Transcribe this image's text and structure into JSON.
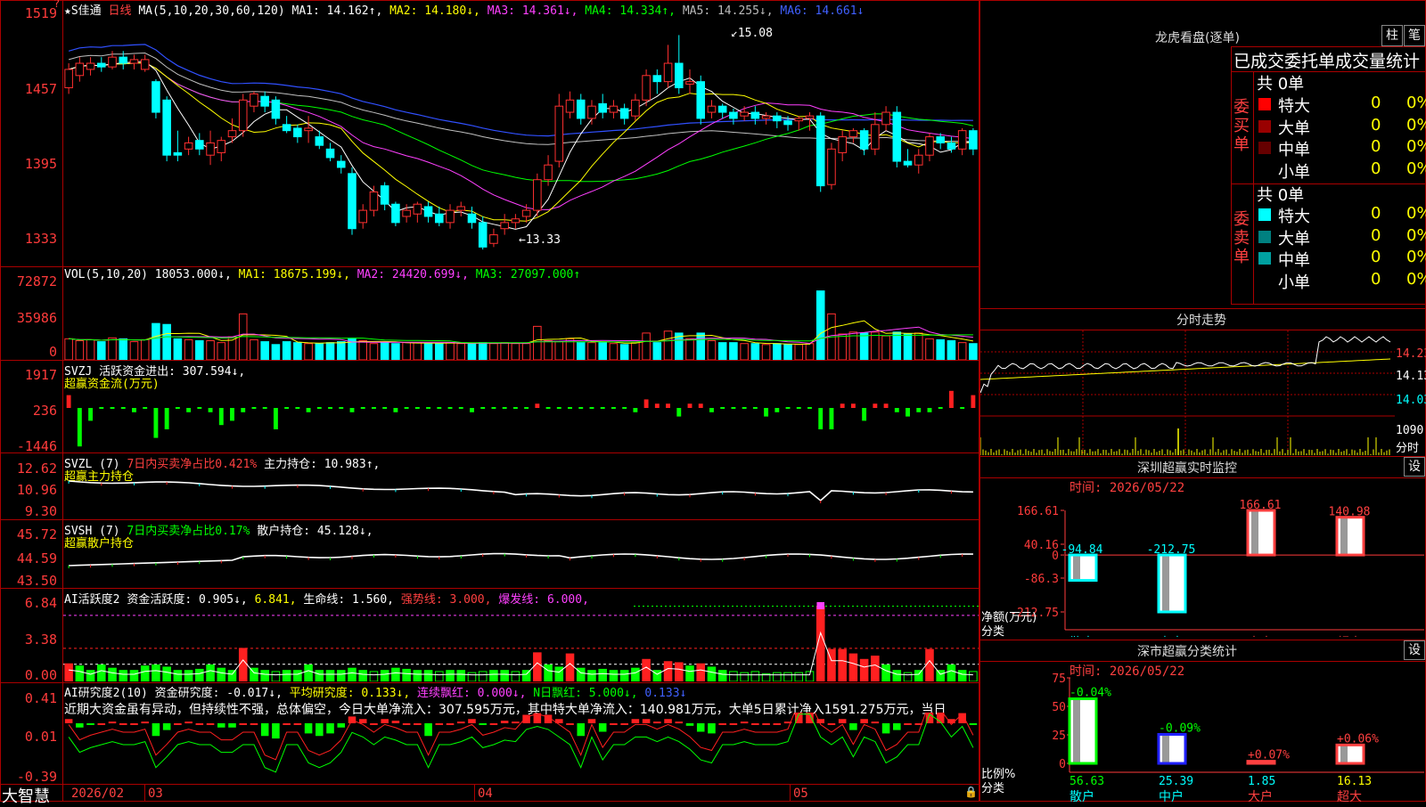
{
  "kline": {
    "header": {
      "title": "★S佳通",
      "period": "日线",
      "ma_label": "MA(5,10,20,30,60,120)",
      "ma1": "MA1: 14.162↑,",
      "ma2": "MA2: 14.180↓,",
      "ma3": "MA3: 14.361↓,",
      "ma4": "MA4: 14.334↑,",
      "ma5": "MA5: 14.255↓,",
      "ma6": "MA6: 14.661↓"
    },
    "yaxis": [
      "1519",
      "1457",
      "1395",
      "1333"
    ],
    "corner_mark": "?",
    "high_label": "15.08",
    "low_label": "13.33",
    "candles": [
      [
        14.65,
        14.8,
        14.6,
        14.85
      ],
      [
        14.75,
        14.85,
        14.7,
        14.9
      ],
      [
        14.8,
        14.85,
        14.75,
        14.9
      ],
      [
        14.85,
        14.82,
        14.78,
        14.9
      ],
      [
        14.82,
        14.9,
        14.8,
        14.95
      ],
      [
        14.9,
        14.85,
        14.8,
        14.95
      ],
      [
        14.85,
        14.88,
        14.8,
        14.92
      ],
      [
        14.8,
        14.88,
        14.78,
        14.92
      ],
      [
        14.7,
        14.45,
        14.4,
        14.72
      ],
      [
        14.55,
        14.1,
        14.05,
        14.58
      ],
      [
        14.12,
        14.1,
        14.05,
        14.3
      ],
      [
        14.15,
        14.2,
        14.1,
        14.25
      ],
      [
        14.22,
        14.15,
        14.1,
        14.28
      ],
      [
        14.1,
        14.2,
        14.02,
        14.3
      ],
      [
        14.12,
        14.22,
        14.05,
        14.25
      ],
      [
        14.25,
        14.3,
        14.2,
        14.4
      ],
      [
        14.3,
        14.55,
        14.25,
        14.6
      ],
      [
        14.5,
        14.6,
        14.45,
        14.62
      ],
      [
        14.58,
        14.5,
        14.45,
        14.62
      ],
      [
        14.55,
        14.4,
        14.35,
        14.58
      ],
      [
        14.35,
        14.3,
        14.28,
        14.42
      ],
      [
        14.32,
        14.25,
        14.2,
        14.35
      ],
      [
        14.3,
        14.32,
        14.2,
        14.42
      ],
      [
        14.25,
        14.18,
        14.15,
        14.3
      ],
      [
        14.15,
        14.08,
        14.05,
        14.2
      ],
      [
        14.05,
        14.0,
        13.95,
        14.1
      ],
      [
        13.95,
        13.5,
        13.45,
        14.0
      ],
      [
        13.55,
        13.65,
        13.5,
        13.7
      ],
      [
        13.65,
        13.8,
        13.6,
        13.85
      ],
      [
        13.85,
        13.7,
        13.65,
        13.88
      ],
      [
        13.7,
        13.55,
        13.52,
        13.72
      ],
      [
        13.6,
        13.65,
        13.55,
        13.7
      ],
      [
        13.62,
        13.7,
        13.55,
        13.72
      ],
      [
        13.68,
        13.6,
        13.55,
        13.72
      ],
      [
        13.62,
        13.55,
        13.52,
        13.68
      ],
      [
        13.55,
        13.65,
        13.5,
        13.7
      ],
      [
        13.65,
        13.68,
        13.6,
        13.72
      ],
      [
        13.62,
        13.55,
        13.5,
        13.68
      ],
      [
        13.55,
        13.35,
        13.33,
        13.6
      ],
      [
        13.38,
        13.45,
        13.35,
        13.5
      ],
      [
        13.5,
        13.55,
        13.45,
        13.62
      ],
      [
        13.55,
        13.58,
        13.5,
        13.62
      ],
      [
        13.6,
        13.65,
        13.55,
        13.7
      ],
      [
        13.65,
        13.9,
        13.6,
        13.95
      ],
      [
        13.9,
        14.02,
        13.85,
        14.1
      ],
      [
        14.05,
        14.5,
        14.0,
        14.6
      ],
      [
        14.45,
        14.55,
        14.4,
        14.62
      ],
      [
        14.55,
        14.4,
        14.35,
        14.6
      ],
      [
        14.4,
        14.5,
        14.35,
        14.55
      ],
      [
        14.52,
        14.45,
        14.4,
        14.6
      ],
      [
        14.45,
        14.5,
        14.4,
        14.55
      ],
      [
        14.48,
        14.4,
        14.35,
        14.52
      ],
      [
        14.42,
        14.55,
        14.38,
        14.6
      ],
      [
        14.55,
        14.75,
        14.5,
        14.8
      ],
      [
        14.75,
        14.7,
        14.6,
        14.8
      ],
      [
        14.7,
        14.85,
        14.65,
        15.0
      ],
      [
        14.85,
        14.65,
        14.6,
        15.08
      ],
      [
        14.68,
        14.7,
        14.6,
        14.8
      ],
      [
        14.7,
        14.4,
        14.35,
        14.75
      ],
      [
        14.45,
        14.5,
        14.4,
        14.55
      ],
      [
        14.5,
        14.45,
        14.4,
        14.52
      ],
      [
        14.45,
        14.4,
        14.35,
        14.48
      ],
      [
        14.42,
        14.45,
        14.38,
        14.5
      ],
      [
        14.45,
        14.4,
        14.35,
        14.5
      ],
      [
        14.4,
        14.42,
        14.35,
        14.45
      ],
      [
        14.42,
        14.38,
        14.32,
        14.45
      ],
      [
        14.38,
        14.35,
        14.3,
        14.42
      ],
      [
        14.38,
        14.4,
        14.3,
        14.42
      ],
      [
        14.4,
        14.42,
        14.3,
        14.45
      ],
      [
        14.42,
        13.85,
        13.8,
        14.45
      ],
      [
        13.86,
        14.15,
        13.82,
        14.2
      ],
      [
        14.12,
        14.25,
        14.05,
        14.3
      ],
      [
        14.25,
        14.3,
        14.2,
        14.32
      ],
      [
        14.3,
        14.15,
        14.1,
        14.32
      ],
      [
        14.15,
        14.35,
        14.1,
        14.45
      ],
      [
        14.35,
        14.45,
        14.3,
        14.5
      ],
      [
        14.45,
        14.05,
        14.0,
        14.5
      ],
      [
        14.05,
        14.02,
        14.0,
        14.15
      ],
      [
        14.02,
        14.1,
        13.95,
        14.15
      ],
      [
        14.1,
        14.25,
        14.05,
        14.28
      ],
      [
        14.25,
        14.2,
        14.15,
        14.28
      ],
      [
        14.2,
        14.15,
        14.12,
        14.25
      ],
      [
        14.15,
        14.3,
        14.1,
        14.32
      ],
      [
        14.3,
        14.15,
        14.1,
        14.32
      ]
    ]
  },
  "vol": {
    "header": {
      "label": "VOL(5,10,20)",
      "value": "18053.000↓,",
      "ma1": "MA1: 18675.199↓,",
      "ma2": "MA2: 24420.699↓,",
      "ma3": "MA3: 27097.000↑"
    },
    "yaxis": [
      "72872",
      "35986",
      "0"
    ],
    "values": [
      22,
      20,
      21,
      19,
      23,
      22,
      19,
      21,
      38,
      37,
      22,
      21,
      20,
      20,
      18,
      24,
      48,
      21,
      19,
      16,
      19,
      18,
      17,
      17,
      18,
      19,
      22,
      20,
      17,
      18,
      17,
      18,
      18,
      17,
      17,
      18,
      17,
      17,
      18,
      17,
      18,
      17,
      17,
      35,
      20,
      19,
      22,
      18,
      18,
      18,
      17,
      16,
      18,
      28,
      18,
      30,
      28,
      22,
      28,
      20,
      18,
      18,
      17,
      17,
      16,
      17,
      16,
      16,
      17,
      72,
      48,
      27,
      29,
      28,
      29,
      25,
      29,
      27,
      28,
      22,
      21,
      20,
      18,
      17
    ]
  },
  "svzj": {
    "header": {
      "label": "SVZJ",
      "name": "活跃资金进出:",
      "value": "307.594↓,",
      "sub": "超赢资金流(万元)"
    },
    "yaxis": [
      "1917",
      "236",
      "-1446"
    ],
    "values": [
      3,
      -9,
      -3,
      0,
      0,
      0,
      -1,
      0,
      -7,
      -5,
      0,
      -1,
      0,
      -1,
      -4,
      -3,
      -1,
      0,
      0,
      -5,
      0,
      0,
      -1,
      0,
      0,
      0,
      -1,
      0,
      0,
      0,
      -1,
      0,
      0,
      0,
      0,
      0,
      0,
      -1,
      0,
      0,
      0,
      0,
      0,
      1,
      0,
      0,
      0,
      0,
      0,
      0,
      0,
      0,
      -1,
      2,
      1,
      1,
      -2,
      1,
      1,
      -1,
      0,
      0,
      0,
      0,
      -2,
      -1,
      0,
      0,
      0,
      -5,
      -5,
      1,
      1,
      -3,
      1,
      1,
      -1,
      -2,
      -1,
      -1,
      0,
      4,
      0,
      3
    ]
  },
  "svzl": {
    "header": {
      "label": "SVZL (7)",
      "desc": "7日内买卖净占比0.421%",
      "name": "主力持仓:",
      "value": "10.983↑,",
      "sub": "超赢主力持仓"
    },
    "yaxis": [
      "12.62",
      "10.96",
      "9.30"
    ]
  },
  "svsh": {
    "header": {
      "label": "SVSH (7)",
      "desc": "7日内买卖净占比0.17%",
      "name": "散户持仓:",
      "value": "45.128↓,",
      "sub": "超赢散户持仓"
    },
    "yaxis": [
      "45.72",
      "44.59",
      "43.50"
    ]
  },
  "ai2": {
    "header": {
      "label": "AI活跃度2",
      "name": "资金活跃度:",
      "v1": "0.905↓,",
      "v2": "6.841,",
      "life": "生命线: 1.560,",
      "strong": "强势线: 3.000,",
      "burst": "爆发线: 6.000,"
    },
    "yaxis": [
      "6.84",
      "3.38",
      "0.00"
    ],
    "values": [
      1.6,
      1.4,
      1.0,
      1.5,
      1.2,
      1.0,
      1.0,
      1.4,
      1.5,
      1.3,
      1.0,
      1.0,
      1.1,
      1.5,
      1.2,
      1.0,
      3.0,
      1.2,
      1.0,
      0.9,
      1.0,
      1.0,
      1.5,
      1.0,
      1.0,
      1.0,
      1.2,
      1.0,
      0.9,
      1.0,
      1.2,
      1.1,
      1.0,
      1.0,
      0.9,
      1.0,
      1.0,
      0.8,
      0.9,
      1.0,
      1.0,
      0.9,
      1.0,
      2.6,
      1.5,
      1.3,
      2.5,
      1.2,
      1.0,
      1.1,
      1.0,
      1.0,
      1.2,
      2.0,
      1.0,
      1.8,
      1.7,
      1.4,
      1.6,
      1.3,
      1.0,
      0.9,
      0.8,
      0.9,
      0.7,
      0.8,
      0.8,
      0.8,
      0.9,
      6.8,
      2.9,
      2.9,
      2.5,
      2.0,
      2.3,
      1.5,
      1.0,
      0.8,
      1.0,
      2.9,
      1.0,
      1.5,
      1.0,
      0.9
    ]
  },
  "air": {
    "header": {
      "label": "AI研究度2(10)",
      "name": "资金研究度:",
      "v1": "-0.017↓,",
      "avg": "平均研究度: 0.133↓,",
      "red": "连续飘红: 0.000↓,",
      "nred": "N日飘红: 5.000↓,",
      "tail": "0.133↓"
    },
    "text": "近期大资金虽有异动，但持续性不强，总体偏空，今日大单净流入：307.595万元，其中特大单净流入：140.981万元，大单5日累计净入1591.275万元，当日",
    "yaxis": [
      "0.41",
      "0.01",
      "-0.39"
    ],
    "values": [
      0.05,
      -0.05,
      -0.02,
      0,
      0.02,
      0,
      0,
      0.02,
      -0.15,
      -0.08,
      0,
      0.02,
      0,
      0,
      -0.05,
      -0.05,
      0,
      0,
      -0.15,
      -0.18,
      0,
      0,
      -0.12,
      -0.15,
      -0.12,
      -0.05,
      0.08,
      0.05,
      0,
      0.05,
      0.03,
      0,
      0,
      -0.15,
      0,
      0,
      0.02,
      0.05,
      -0.02,
      0,
      0.03,
      0.02,
      0.1,
      0.12,
      0.1,
      0.05,
      0,
      -0.15,
      0.05,
      -0.1,
      0,
      0,
      0.05,
      0.05,
      0.02,
      0.05,
      0.02,
      -0.03,
      -0.1,
      -0.12,
      0,
      0,
      0.02,
      0,
      0,
      0,
      0.02,
      0.2,
      0.2,
      0.05,
      0,
      0.05,
      -0.08,
      0.05,
      0.02,
      -0.12,
      -0.08,
      0,
      0,
      0.2,
      0.15,
      0.05,
      0.12,
      -0.02
    ]
  },
  "xaxis": {
    "brand": "大智慧",
    "labels": [
      "2026/02",
      "03",
      "04",
      "05"
    ]
  },
  "right": {
    "dragon": {
      "title": "龙虎看盘(逐单)",
      "btn1": "柱",
      "btn2": "笔",
      "subtitle": "已成交委托单成交量统计",
      "buy": {
        "side": "委买单",
        "total": "共 0单",
        "rows": [
          {
            "name": "特大",
            "count": "0",
            "pct": "0%",
            "color": "#ff0000"
          },
          {
            "name": "大单",
            "count": "0",
            "pct": "0%",
            "color": "#990000"
          },
          {
            "name": "中单",
            "count": "0",
            "pct": "0%",
            "color": "#660000"
          },
          {
            "name": "小单",
            "count": "0",
            "pct": "0%",
            "color": ""
          }
        ]
      },
      "sell": {
        "side": "委卖单",
        "total": "共 0单",
        "rows": [
          {
            "name": "特大",
            "count": "0",
            "pct": "0%",
            "color": "#00ffff"
          },
          {
            "name": "大单",
            "count": "0",
            "pct": "0%",
            "color": "#008080"
          },
          {
            "name": "中单",
            "count": "0",
            "pct": "0%",
            "color": "#00a0a0"
          },
          {
            "name": "小单",
            "count": "0",
            "pct": "0%",
            "color": ""
          }
        ]
      }
    },
    "intraday": {
      "title": "分时走势",
      "prices": [
        "14.23",
        "14.13",
        "14.03"
      ],
      "vol_top": "1090",
      "vol_label": "分时"
    },
    "sz_monitor": {
      "title": "深圳超赢实时监控",
      "btn": "设",
      "time": "时间: 2026/05/22",
      "yaxis": [
        "166.61",
        "40.16",
        "0",
        "-86.3",
        "-212.75"
      ],
      "ylabel": "净额(万元)",
      "xlabel": "分类",
      "bars": [
        {
          "name": "散户",
          "value": -94.84,
          "label": "-94.84"
        },
        {
          "name": "中户",
          "value": -212.75,
          "label": "-212.75"
        },
        {
          "name": "大户",
          "value": 166.61,
          "label": "166.61"
        },
        {
          "name": "超大",
          "value": 140.98,
          "label": "140.98"
        }
      ]
    },
    "sz_class": {
      "title": "深市超赢分类统计",
      "btn": "设",
      "time": "时间: 2026/05/22",
      "yaxis": [
        "75",
        "50",
        "25",
        "0"
      ],
      "ylabel": "比例%",
      "xlabel": "分类",
      "bars": [
        {
          "name": "散户",
          "value": 56.63,
          "label": "56.63",
          "top": "-0.04%"
        },
        {
          "name": "中户",
          "value": 25.39,
          "label": "25.39",
          "top": "-0.09%"
        },
        {
          "name": "大户",
          "value": 1.85,
          "label": "1.85",
          "top": "+0.07%"
        },
        {
          "name": "超大",
          "value": 16.13,
          "label": "16.13",
          "top": "+0.06%"
        }
      ]
    }
  },
  "colors": {
    "up": "#ff3030",
    "down": "#00ffff",
    "frame": "#aa0000",
    "ma1": "#ffffff",
    "ma2": "#ffff00",
    "ma3": "#ff40ff",
    "ma4": "#00ff00",
    "ma5": "#c0c0c0",
    "ma6": "#3050ff"
  }
}
